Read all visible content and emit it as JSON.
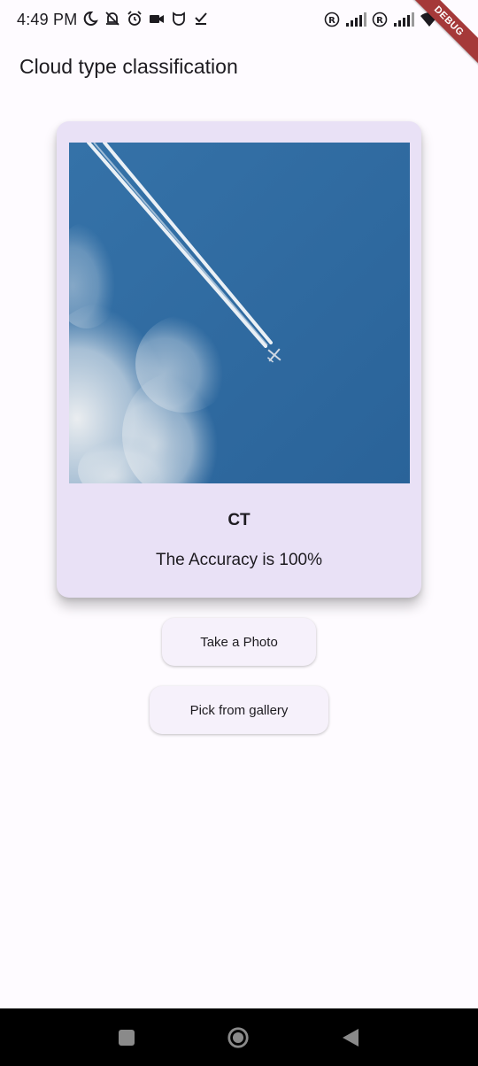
{
  "status_bar": {
    "time": "4:49 PM",
    "left_icons": [
      "moon-icon",
      "bell-off-icon",
      "alarm-icon",
      "video-icon",
      "mi-shield-icon",
      "check-icon"
    ],
    "right_icons": [
      "roaming-icon",
      "signal-icon",
      "roaming-icon",
      "signal-icon",
      "wifi-icon",
      "battery-icon"
    ]
  },
  "debug_banner": "DEBUG",
  "app_bar": {
    "title": "Cloud type classification"
  },
  "result": {
    "label": "CT",
    "accuracy_text": "The Accuracy is 100%",
    "accuracy": 1.0
  },
  "actions": {
    "take_photo": "Take a Photo",
    "pick_gallery": "Pick from gallery"
  },
  "nav_bar": {
    "buttons": [
      "recents-icon",
      "home-icon",
      "back-icon"
    ]
  },
  "colors": {
    "background": "#fefbff",
    "card": "#e9e1f6",
    "button": "#f6f1fb",
    "sky": "#2f689e"
  }
}
